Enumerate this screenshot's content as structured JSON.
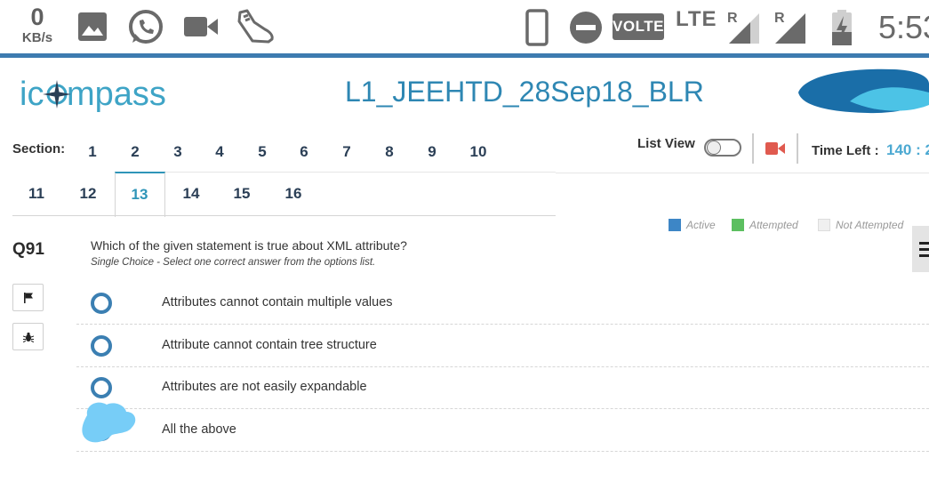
{
  "status_bar": {
    "net_speed_value": "0",
    "net_speed_unit": "KB/s",
    "icons_left": [
      "image-icon",
      "whatsapp-icon",
      "video-camera-icon",
      "sneaker-icon"
    ],
    "icons_right": [
      "phone-icon",
      "do-not-disturb-icon"
    ],
    "volte_label": "VOLTE",
    "lte_label": "LTE",
    "roaming_marks": [
      "R",
      "R"
    ],
    "clock": "5:53",
    "colors": {
      "icon": "#6a6a6a",
      "rule": "#3d7bb0"
    }
  },
  "header": {
    "logo_text": "icompass",
    "test_title": "L1_JEEHTD_28Sep18_BLR",
    "colors": {
      "title": "#2e87b3",
      "logo": "#3ea4c6"
    }
  },
  "sections": {
    "label": "Section:",
    "items": [
      "1",
      "2",
      "3",
      "4",
      "5",
      "6",
      "7",
      "8",
      "9",
      "10",
      "11",
      "12",
      "13",
      "14",
      "15",
      "16"
    ],
    "active": "13"
  },
  "toolbar": {
    "list_view_label": "List View",
    "list_view_enabled": false,
    "time_left_label": "Time Left :",
    "time_left_value": "140 : 2"
  },
  "legend": [
    {
      "label": "Active",
      "color": "#3d86c6"
    },
    {
      "label": "Attempted",
      "color": "#5cbf60"
    },
    {
      "label": "Not Attempted",
      "color": "#f0f0f0"
    }
  ],
  "question": {
    "number": "Q91",
    "text": "Which of the given statement is true about XML attribute?",
    "hint": "Single Choice - Select one correct answer from the options list.",
    "side_buttons": [
      "flag-icon",
      "bug-icon"
    ],
    "options": [
      "Attributes cannot contain multiple values",
      "Attribute cannot contain tree structure",
      "Attributes are not easily expandable",
      "All the above"
    ]
  }
}
